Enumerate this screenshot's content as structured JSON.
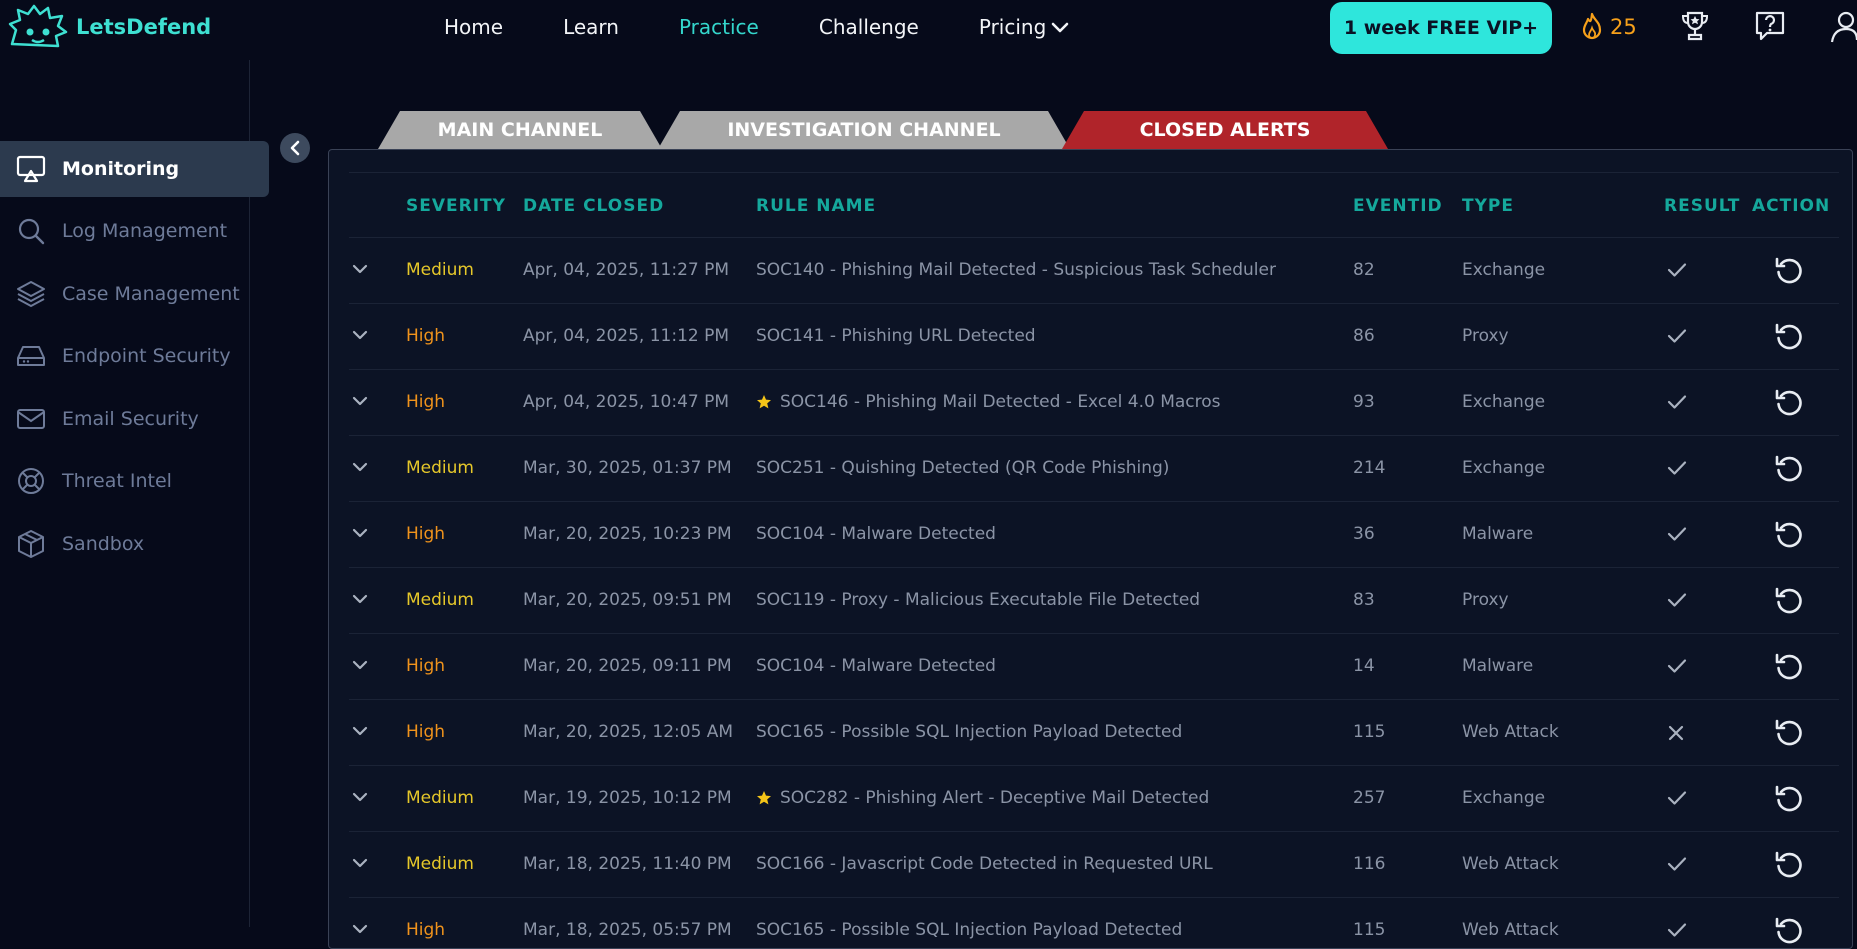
{
  "app": {
    "name": "LetsDefend"
  },
  "nav": {
    "home": "Home",
    "learn": "Learn",
    "practice": "Practice",
    "challenge": "Challenge",
    "pricing": "Pricing"
  },
  "vip_button": "1 week FREE VIP+",
  "streak_count": "25",
  "sidebar": {
    "items": [
      {
        "label": "Monitoring",
        "icon": "monitor-icon",
        "active": true
      },
      {
        "label": "Log Management",
        "icon": "search-icon",
        "active": false
      },
      {
        "label": "Case Management",
        "icon": "layers-icon",
        "active": false
      },
      {
        "label": "Endpoint Security",
        "icon": "drive-icon",
        "active": false
      },
      {
        "label": "Email Security",
        "icon": "mail-icon",
        "active": false
      },
      {
        "label": "Threat Intel",
        "icon": "lifebuoy-icon",
        "active": false
      },
      {
        "label": "Sandbox",
        "icon": "box-icon",
        "active": false
      }
    ]
  },
  "tabs": [
    {
      "label": "MAIN CHANNEL",
      "color": "#a8a8a8"
    },
    {
      "label": "INVESTIGATION CHANNEL",
      "color": "#a8a8a8"
    },
    {
      "label": "CLOSED ALERTS",
      "color": "#b0242a"
    }
  ],
  "table": {
    "columns": [
      "SEVERITY",
      "DATE CLOSED",
      "RULE NAME",
      "EVENTID",
      "TYPE",
      "RESULT",
      "ACTION"
    ],
    "rows": [
      {
        "severity": "Medium",
        "date": "Apr, 04, 2025, 11:27 PM",
        "rule": "SOC140 - Phishing Mail Detected - Suspicious Task Scheduler",
        "starred": false,
        "eventid": "82",
        "type": "Exchange",
        "result": "check"
      },
      {
        "severity": "High",
        "date": "Apr, 04, 2025, 11:12 PM",
        "rule": "SOC141 - Phishing URL Detected",
        "starred": false,
        "eventid": "86",
        "type": "Proxy",
        "result": "check"
      },
      {
        "severity": "High",
        "date": "Apr, 04, 2025, 10:47 PM",
        "rule": "SOC146 - Phishing Mail Detected - Excel 4.0 Macros",
        "starred": true,
        "eventid": "93",
        "type": "Exchange",
        "result": "check"
      },
      {
        "severity": "Medium",
        "date": "Mar, 30, 2025, 01:37 PM",
        "rule": "SOC251 - Quishing Detected (QR Code Phishing)",
        "starred": false,
        "eventid": "214",
        "type": "Exchange",
        "result": "check"
      },
      {
        "severity": "High",
        "date": "Mar, 20, 2025, 10:23 PM",
        "rule": "SOC104 - Malware Detected",
        "starred": false,
        "eventid": "36",
        "type": "Malware",
        "result": "check"
      },
      {
        "severity": "Medium",
        "date": "Mar, 20, 2025, 09:51 PM",
        "rule": "SOC119 - Proxy - Malicious Executable File Detected",
        "starred": false,
        "eventid": "83",
        "type": "Proxy",
        "result": "check"
      },
      {
        "severity": "High",
        "date": "Mar, 20, 2025, 09:11 PM",
        "rule": "SOC104 - Malware Detected",
        "starred": false,
        "eventid": "14",
        "type": "Malware",
        "result": "check"
      },
      {
        "severity": "High",
        "date": "Mar, 20, 2025, 12:05 AM",
        "rule": "SOC165 - Possible SQL Injection Payload Detected",
        "starred": false,
        "eventid": "115",
        "type": "Web Attack",
        "result": "cross"
      },
      {
        "severity": "Medium",
        "date": "Mar, 19, 2025, 10:12 PM",
        "rule": "SOC282 - Phishing Alert - Deceptive Mail Detected",
        "starred": true,
        "eventid": "257",
        "type": "Exchange",
        "result": "check"
      },
      {
        "severity": "Medium",
        "date": "Mar, 18, 2025, 11:40 PM",
        "rule": "SOC166 - Javascript Code Detected in Requested URL",
        "starred": false,
        "eventid": "116",
        "type": "Web Attack",
        "result": "check"
      },
      {
        "severity": "High",
        "date": "Mar, 18, 2025, 05:57 PM",
        "rule": "SOC165 - Possible SQL Injection Payload Detected",
        "starred": false,
        "eventid": "115",
        "type": "Web Attack",
        "result": "check"
      }
    ]
  }
}
